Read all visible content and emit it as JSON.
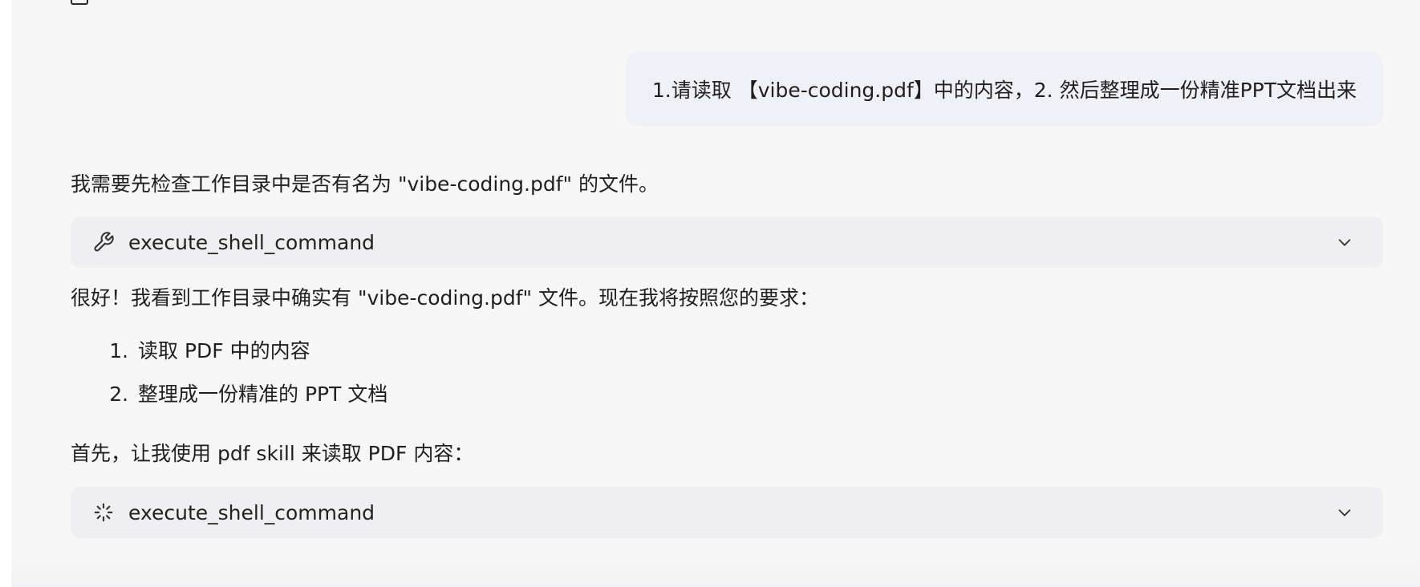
{
  "conversation": {
    "user_message": "1.请读取 【vibe-coding.pdf】中的内容，2. 然后整理成一份精准PPT文档出来",
    "assistant": {
      "intro_text": "我需要先检查工作目录中是否有名为 \"vibe-coding.pdf\" 的文件。",
      "tool_call_1": {
        "label": "execute_shell_command",
        "icon": "wrench-icon",
        "status": "done"
      },
      "confirm_text": "很好！我看到工作目录中确实有 \"vibe-coding.pdf\" 文件。现在我将按照您的要求：",
      "steps": [
        "读取 PDF 中的内容",
        "整理成一份精准的 PPT 文档"
      ],
      "next_text": "首先，让我使用 pdf skill 来读取 PDF 内容：",
      "tool_call_2": {
        "label": "execute_shell_command",
        "icon": "loading-spinner-icon",
        "status": "running"
      }
    }
  }
}
